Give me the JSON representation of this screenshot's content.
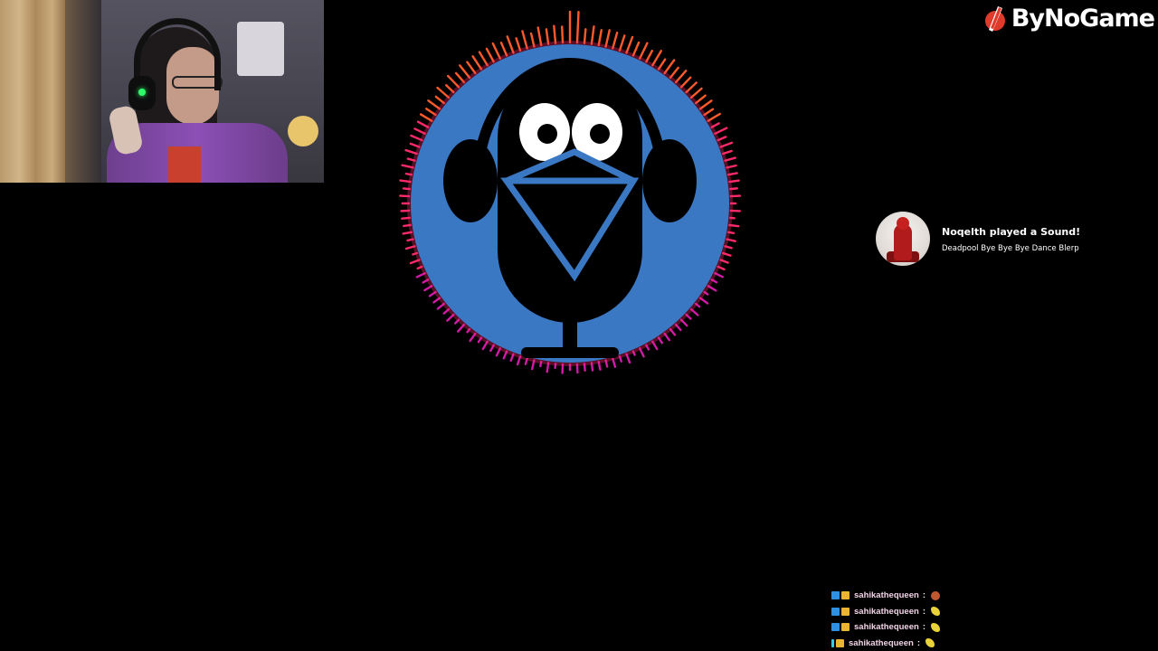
{
  "brand": {
    "name": "ByNoGame",
    "accent_color": "#e03a2a"
  },
  "alert": {
    "title": "Noqelth played a Sound!",
    "subtitle": "Deadpool Bye Bye Bye Dance Blerp",
    "avatar_icon": "deadpool-avatar"
  },
  "center_logo": {
    "icon": "microphone-mascot-logo",
    "disc_color": "#3a78c4",
    "ring_colors": [
      "#ff5a2a",
      "#ff2a6a",
      "#d21aa8"
    ]
  },
  "webcam": {
    "description_icon": "webcam-feed"
  },
  "chat": {
    "messages": [
      {
        "badges": [
          "blue",
          "gold"
        ],
        "username": "sahikathequeen",
        "separator": ":",
        "emote": "red"
      },
      {
        "badges": [
          "blue",
          "gold"
        ],
        "username": "sahikathequeen",
        "separator": ":",
        "emote": "yellow"
      },
      {
        "badges": [
          "blue",
          "gold"
        ],
        "username": "sahikathequeen",
        "separator": ":",
        "emote": "yellow"
      },
      {
        "badges": [
          "cyan",
          "gold"
        ],
        "username": "sahikathequeen",
        "separator": ":",
        "emote": "yellow"
      }
    ]
  }
}
